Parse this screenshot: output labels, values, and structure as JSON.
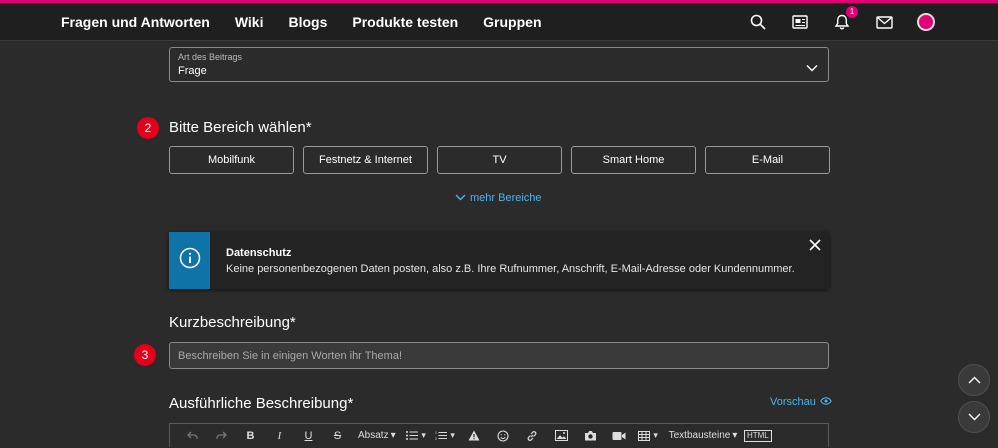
{
  "nav": {
    "links": [
      "Fragen und Antworten",
      "Wiki",
      "Blogs",
      "Produkte testen",
      "Gruppen"
    ],
    "notification_count": "1"
  },
  "post_type": {
    "label": "Art des Beitrags",
    "value": "Frage"
  },
  "steps": {
    "area_num": "2",
    "short_num": "3"
  },
  "area": {
    "title": "Bitte Bereich wählen*",
    "buttons": [
      "Mobilfunk",
      "Festnetz & Internet",
      "TV",
      "Smart Home",
      "E-Mail"
    ],
    "more": "mehr Bereiche"
  },
  "privacy": {
    "title": "Datenschutz",
    "text": "Keine personenbezogenen Daten posten, also z.B. Ihre Rufnummer, Anschrift, E-Mail-Adresse oder Kundennummer."
  },
  "short_desc": {
    "title": "Kurzbeschreibung*",
    "placeholder": "Beschreiben Sie in einigen Worten ihr Thema!"
  },
  "long_desc": {
    "title": "Ausführliche Beschreibung*",
    "preview": "Vorschau"
  },
  "toolbar": {
    "paragraph": "Absatz",
    "snippets": "Textbausteine",
    "html": "HTML"
  },
  "colors": {
    "brand": "#e20074",
    "step": "#e2001a",
    "link": "#4fb3e8",
    "info": "#0f73a8"
  }
}
